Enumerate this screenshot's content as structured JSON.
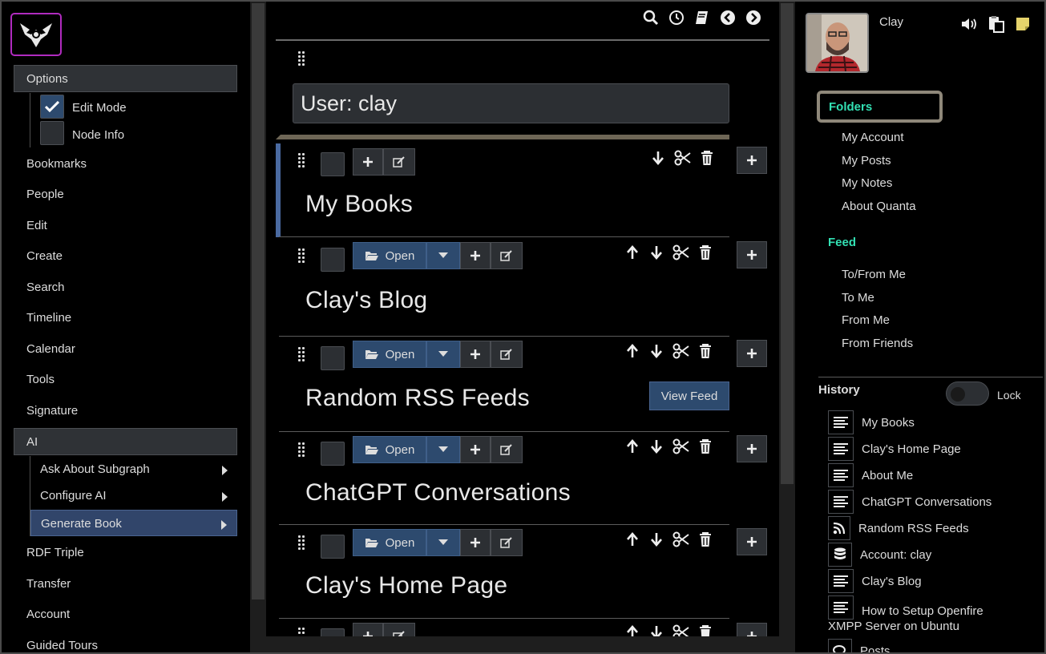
{
  "left": {
    "options_label": "Options",
    "edit_mode_label": "Edit Mode",
    "node_info_label": "Node Info",
    "items": [
      "Bookmarks",
      "People",
      "Edit",
      "Create",
      "Search",
      "Timeline",
      "Calendar",
      "Tools",
      "Signature"
    ],
    "ai_label": "AI",
    "ai_sub": [
      "Ask About Subgraph",
      "Configure AI",
      "Generate Book"
    ],
    "items_bottom": [
      "RDF Triple",
      "Transfer",
      "Account",
      "Guided Tours"
    ]
  },
  "center": {
    "user_heading": "User: clay",
    "open_label": "Open",
    "view_feed_label": "View Feed",
    "nodes": [
      {
        "title": "My Books"
      },
      {
        "title": "Clay's Blog"
      },
      {
        "title": "Random RSS Feeds"
      },
      {
        "title": "ChatGPT Conversations"
      },
      {
        "title": "Clay's Home Page"
      }
    ]
  },
  "right": {
    "username": "Clay",
    "folders_label": "Folders",
    "folder_links": [
      "My Account",
      "My Posts",
      "My Notes",
      "About Quanta"
    ],
    "feed_label": "Feed",
    "feed_links": [
      "To/From Me",
      "To Me",
      "From Me",
      "From Friends"
    ],
    "history_label": "History",
    "lock_label": "Lock",
    "history": [
      {
        "label": "My Books",
        "icon": "list-icon"
      },
      {
        "label": "Clay's Home Page",
        "icon": "list-icon"
      },
      {
        "label": "About Me",
        "icon": "list-icon"
      },
      {
        "label": "ChatGPT Conversations",
        "icon": "list-icon"
      },
      {
        "label": "Random RSS Feeds",
        "icon": "rss-icon"
      },
      {
        "label": "Account: clay",
        "icon": "database-icon"
      },
      {
        "label": "Clay's Blog",
        "icon": "list-icon"
      },
      {
        "label": "How to Setup Openfire",
        "label2": "XMPP Server on Ubuntu",
        "icon": "list-icon"
      },
      {
        "label": "Posts",
        "icon": "comments-icon"
      }
    ]
  },
  "colors": {
    "accent_blue": "#2d4a6e",
    "teal": "#32e0b3",
    "logo_border": "#b02bbf"
  }
}
